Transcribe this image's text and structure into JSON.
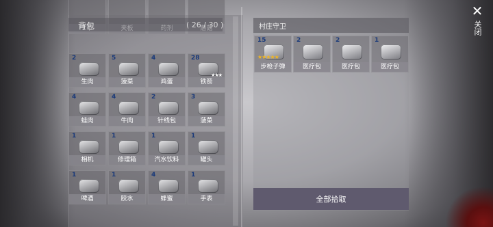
{
  "backpack": {
    "title": "背包",
    "count": "( 26 / 30 )",
    "partial_row": [
      "Z币",
      "夹板",
      "药剂",
      "蘑菇"
    ],
    "items": [
      {
        "num": "2",
        "label": "生肉",
        "icon": "raw-meat-icon"
      },
      {
        "num": "5",
        "label": "菠菜",
        "icon": "spinach-icon"
      },
      {
        "num": "4",
        "label": "鸡蛋",
        "icon": "egg-icon"
      },
      {
        "num": "28",
        "label": "铁箭",
        "icon": "iron-arrow-icon",
        "stars": "★★★"
      },
      {
        "num": "4",
        "label": "蛙肉",
        "icon": "frog-meat-icon"
      },
      {
        "num": "4",
        "label": "牛肉",
        "icon": "beef-icon"
      },
      {
        "num": "2",
        "label": "针线包",
        "icon": "sewing-kit-icon"
      },
      {
        "num": "3",
        "label": "菠菜",
        "icon": "spinach-icon"
      },
      {
        "num": "1",
        "label": "相机",
        "icon": "camera-icon"
      },
      {
        "num": "1",
        "label": "修理箱",
        "icon": "repair-kit-icon"
      },
      {
        "num": "1",
        "label": "汽水饮料",
        "icon": "soda-icon"
      },
      {
        "num": "1",
        "label": "罐头",
        "icon": "can-icon"
      },
      {
        "num": "1",
        "label": "啤酒",
        "icon": "beer-icon"
      },
      {
        "num": "1",
        "label": "胶水",
        "icon": "glue-icon"
      },
      {
        "num": "4",
        "label": "蜂蜜",
        "icon": "honey-icon"
      },
      {
        "num": "1",
        "label": "手表",
        "icon": "watch-icon"
      }
    ]
  },
  "loot": {
    "title": "村庄守卫",
    "items": [
      {
        "num": "15",
        "label": "步枪子弹",
        "icon": "rifle-bullets-icon",
        "stars": "★★★★★"
      },
      {
        "num": "2",
        "label": "医疗包",
        "icon": "medkit-icon"
      },
      {
        "num": "2",
        "label": "医疗包",
        "icon": "medkit-icon"
      },
      {
        "num": "1",
        "label": "医疗包",
        "icon": "medkit-icon"
      }
    ],
    "pickup_all": "全部拾取"
  },
  "close": {
    "label": "关闭",
    "glyph": "✕"
  }
}
